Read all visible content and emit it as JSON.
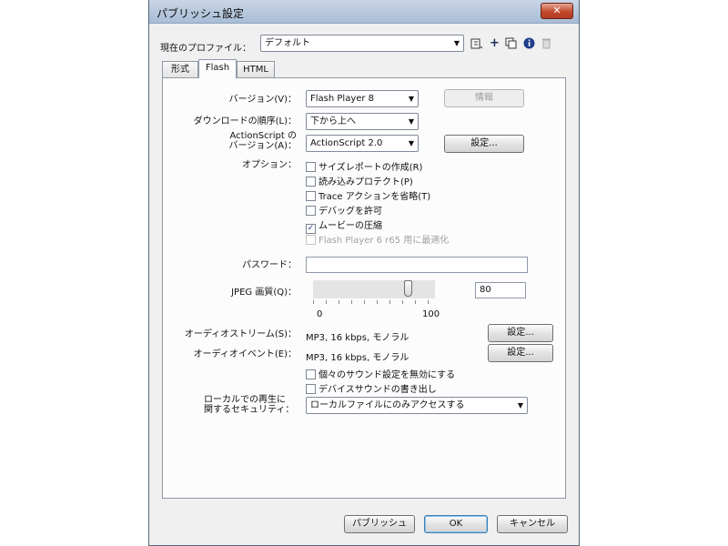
{
  "window": {
    "title": "パブリッシュ設定",
    "close_label": "✕"
  },
  "profile": {
    "label": "現在のプロファイル：",
    "value": "デフォルト",
    "icons": [
      "import-export-icon",
      "add-icon",
      "duplicate-icon",
      "info-icon",
      "trash-icon"
    ]
  },
  "tabs": [
    {
      "label": "形式",
      "active": false
    },
    {
      "label": "Flash",
      "active": true
    },
    {
      "label": "HTML",
      "active": false
    }
  ],
  "flash": {
    "version": {
      "label": "バージョン(V)：",
      "value": "Flash Player 8",
      "info_button": "情報"
    },
    "load_order": {
      "label": "ダウンロードの順序(L)：",
      "value": "下から上へ"
    },
    "actionscript": {
      "label_line1": "ActionScript の",
      "label_line2": "バージョン(A)：",
      "value": "ActionScript 2.0",
      "settings_button": "設定..."
    },
    "options": {
      "label": "オプション：",
      "items": [
        {
          "label": "サイズレポートの作成(R)",
          "checked": false,
          "enabled": true
        },
        {
          "label": "読み込みプロテクト(P)",
          "checked": false,
          "enabled": true
        },
        {
          "label": "Trace アクションを省略(T)",
          "checked": false,
          "enabled": true
        },
        {
          "label": "デバッグを許可",
          "checked": false,
          "enabled": true
        },
        {
          "label": "ムービーの圧縮",
          "checked": true,
          "enabled": true
        },
        {
          "label": "Flash Player 6 r65 用に最適化",
          "checked": false,
          "enabled": false
        }
      ]
    },
    "password": {
      "label": "パスワード：",
      "value": ""
    },
    "jpeg": {
      "label": "JPEG 画質(Q)：",
      "value": "80",
      "min_label": "0",
      "max_label": "100",
      "quality": 80
    },
    "audio_stream": {
      "label": "オーディオストリーム(S)：",
      "value": "MP3, 16 kbps, モノラル",
      "settings_button": "設定..."
    },
    "audio_event": {
      "label": "オーディオイベント(E)：",
      "value": "MP3, 16 kbps, モノラル",
      "settings_button": "設定..."
    },
    "audio_options": [
      {
        "label": "個々のサウンド設定を無効にする",
        "checked": false
      },
      {
        "label": "デバイスサウンドの書き出し",
        "checked": false
      }
    ],
    "security": {
      "label_line1": "ローカルでの再生に",
      "label_line2": "関するセキュリティ：",
      "value": "ローカルファイルにのみアクセスする"
    }
  },
  "footer": {
    "publish": "パブリッシュ",
    "ok": "OK",
    "cancel": "キャンセル"
  },
  "colors": {
    "title_bar": "#b4c6dc",
    "close_button": "#c24a2c",
    "dialog_bg": "#f0f0f0"
  }
}
